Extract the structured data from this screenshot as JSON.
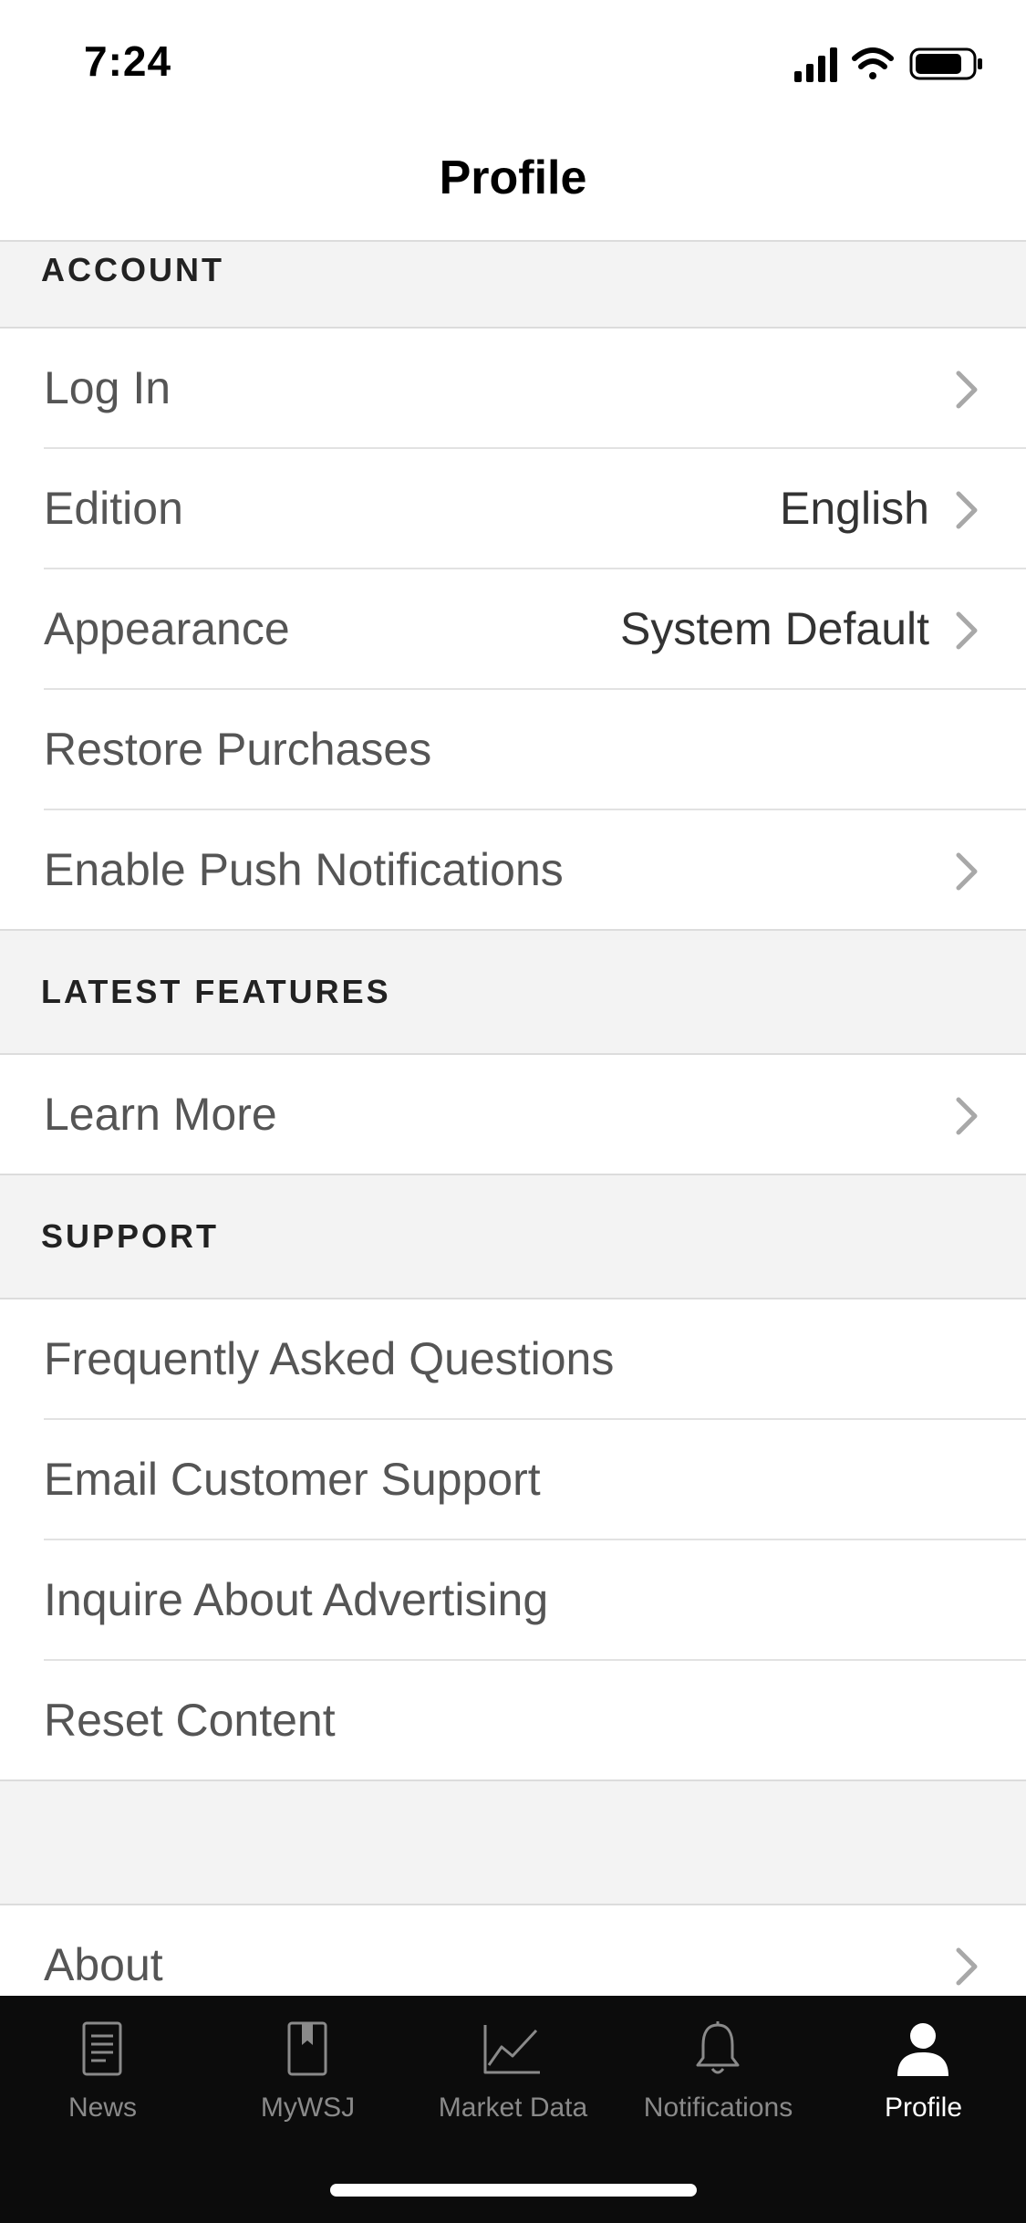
{
  "status_bar": {
    "time": "7:24"
  },
  "header": {
    "title": "Profile"
  },
  "sections": {
    "account": {
      "title": "ACCOUNT",
      "rows": [
        {
          "label": "Log In"
        },
        {
          "label": "Edition",
          "value": "English"
        },
        {
          "label": "Appearance",
          "value": "System Default"
        },
        {
          "label": "Restore Purchases"
        },
        {
          "label": "Enable Push Notifications"
        }
      ]
    },
    "latest_features": {
      "title": "LATEST FEATURES",
      "rows": [
        {
          "label": "Learn More"
        }
      ]
    },
    "support": {
      "title": "SUPPORT",
      "rows": [
        {
          "label": "Frequently Asked Questions"
        },
        {
          "label": "Email Customer Support"
        },
        {
          "label": "Inquire About Advertising"
        },
        {
          "label": "Reset Content"
        }
      ]
    },
    "about": {
      "rows": [
        {
          "label": "About"
        }
      ]
    }
  },
  "tab_bar": {
    "tabs": [
      {
        "label": "News",
        "icon": "newspaper-icon"
      },
      {
        "label": "MyWSJ",
        "icon": "bookmark-icon"
      },
      {
        "label": "Market Data",
        "icon": "line-chart-icon"
      },
      {
        "label": "Notifications",
        "icon": "bell-icon"
      },
      {
        "label": "Profile",
        "icon": "person-icon",
        "active": true
      }
    ]
  },
  "colors": {
    "tab_bar_bg": "#0c0c0c",
    "section_bg": "#f3f3f3",
    "row_text": "#555555",
    "active_tab": "#ffffff",
    "inactive_tab": "#8a8a8a"
  }
}
